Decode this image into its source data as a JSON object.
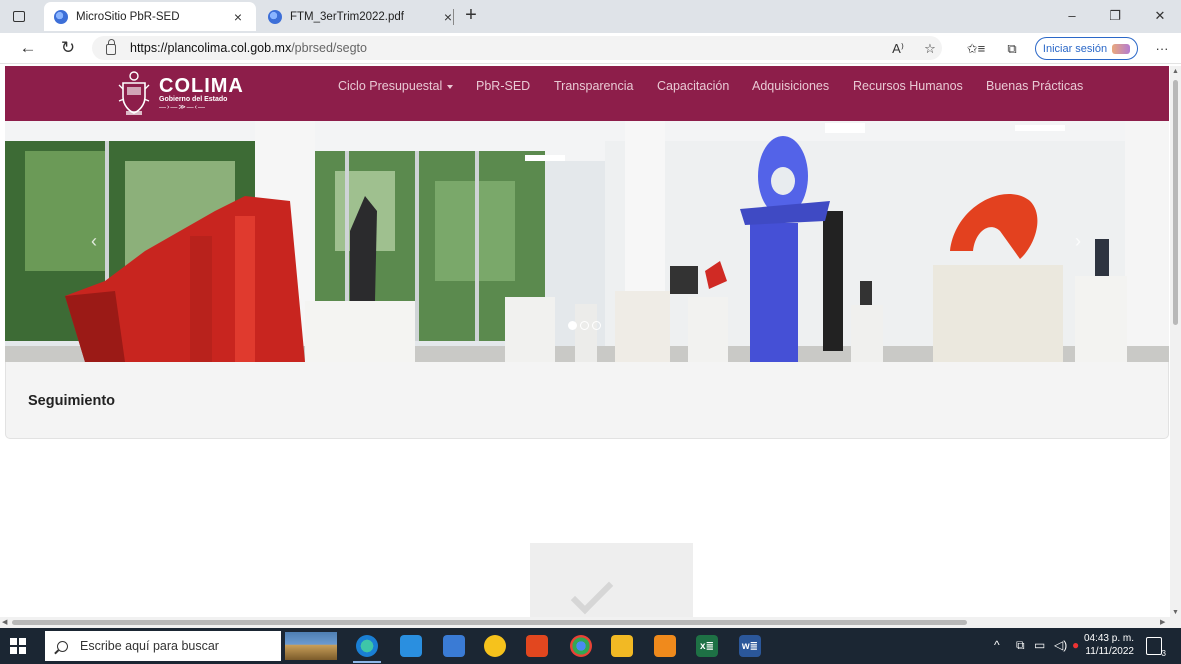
{
  "browser": {
    "tabs": [
      {
        "title": "MicroSitio PbR-SED",
        "close": "×",
        "active": true
      },
      {
        "title": "FTM_3erTrim2022.pdf",
        "close": "×",
        "active": false
      }
    ],
    "new_tab": "+",
    "window_controls": {
      "minimize": "–",
      "restore": "❐",
      "close": "✕"
    },
    "nav": {
      "back": "←",
      "reload": "↻"
    },
    "url_host": "https://plancolima.col.gob.mx",
    "url_path": "/pbrsed/segto",
    "toolbar_icons": {
      "read_aloud": "A⁾",
      "favorites_add": "☆",
      "favorites": "✩≡",
      "collections": "⧉",
      "more": "···"
    },
    "signin_label": "Iniciar sesión"
  },
  "site": {
    "logo_name": "COLIMA",
    "logo_sub": "Gobierno del Estado",
    "logo_ornament": "—›—≫—‹—",
    "brand_color": "#8d1e4a",
    "nav": [
      {
        "label": "Ciclo Presupuestal",
        "dropdown": true
      },
      {
        "label": "PbR-SED"
      },
      {
        "label": "Transparencia"
      },
      {
        "label": "Capacitación"
      },
      {
        "label": "Adquisiciones"
      },
      {
        "label": "Recursos Humanos"
      },
      {
        "label": "Buenas Prácticas"
      }
    ],
    "carousel": {
      "slide_count": 3,
      "active_slide": 1,
      "prev": "‹",
      "next": "›"
    },
    "section_title": "Seguimiento"
  },
  "taskbar": {
    "search_placeholder": "Escribe aquí para buscar",
    "apps": [
      "edge-icon",
      "mail-icon",
      "store-icon",
      "norton-icon",
      "office-icon",
      "chrome-icon",
      "file-explorer-icon",
      "colima-app-icon",
      "excel-icon",
      "word-icon"
    ],
    "excel_label": "x≣",
    "word_label": "w≣",
    "tray_chevron": "^",
    "time": "04:43 p. m.",
    "date": "11/11/2022",
    "notifications": "3"
  }
}
